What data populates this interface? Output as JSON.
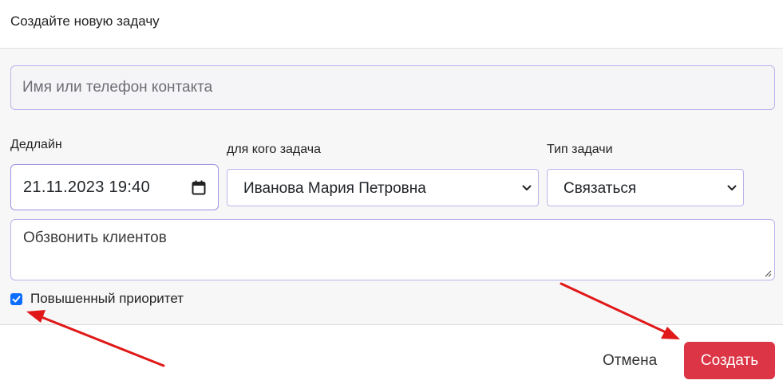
{
  "header": {
    "title": "Создайте новую задачу"
  },
  "contact": {
    "placeholder": "Имя или телефон контакта"
  },
  "deadline": {
    "label": "Дедлайн",
    "value": "21.11.2023 19:40"
  },
  "assignee": {
    "label": "для кого задача",
    "value": "Иванова Мария Петровна"
  },
  "task_type": {
    "label": "Тип задачи",
    "value": "Связаться"
  },
  "description": {
    "value": "Обзвонить клиентов"
  },
  "priority": {
    "label": "Повышенный приоритет",
    "checked": true
  },
  "footer": {
    "cancel_label": "Отмена",
    "create_label": "Создать"
  },
  "colors": {
    "accent": "#0d6efd",
    "danger": "#dc3545",
    "annotation": "#e01818",
    "border": "#b9b4ea"
  }
}
